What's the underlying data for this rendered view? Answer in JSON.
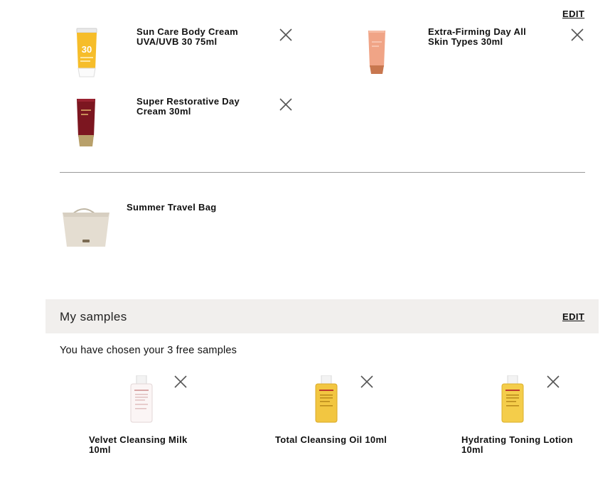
{
  "cart": {
    "edit_label": "EDIT",
    "products": [
      {
        "name": "Sun Care Body Cream UVA/UVB 30 75ml",
        "icon": "sun-cream-tube-icon",
        "badge": "30"
      },
      {
        "name": "Extra-Firming Day All Skin Types 30ml",
        "icon": "peach-tube-icon"
      },
      {
        "name": "Super Restorative Day Cream 30ml",
        "icon": "red-tube-icon"
      }
    ],
    "gift": {
      "name": "Summer Travel Bag",
      "icon": "tote-bag-icon"
    }
  },
  "samples": {
    "title": "My samples",
    "edit_label": "EDIT",
    "note": "You have chosen your 3 free samples",
    "items": [
      {
        "name": "Velvet Cleansing Milk 10ml",
        "icon": "white-bottle-icon"
      },
      {
        "name": "Total Cleansing Oil 10ml",
        "icon": "yellow-bottle-icon"
      },
      {
        "name": "Hydrating Toning Lotion 10ml",
        "icon": "yellow-bottle-icon"
      }
    ]
  },
  "colors": {
    "samples_bar_bg": "#f1efed",
    "divider": "#9a9a9a",
    "close_icon": "#555555"
  }
}
